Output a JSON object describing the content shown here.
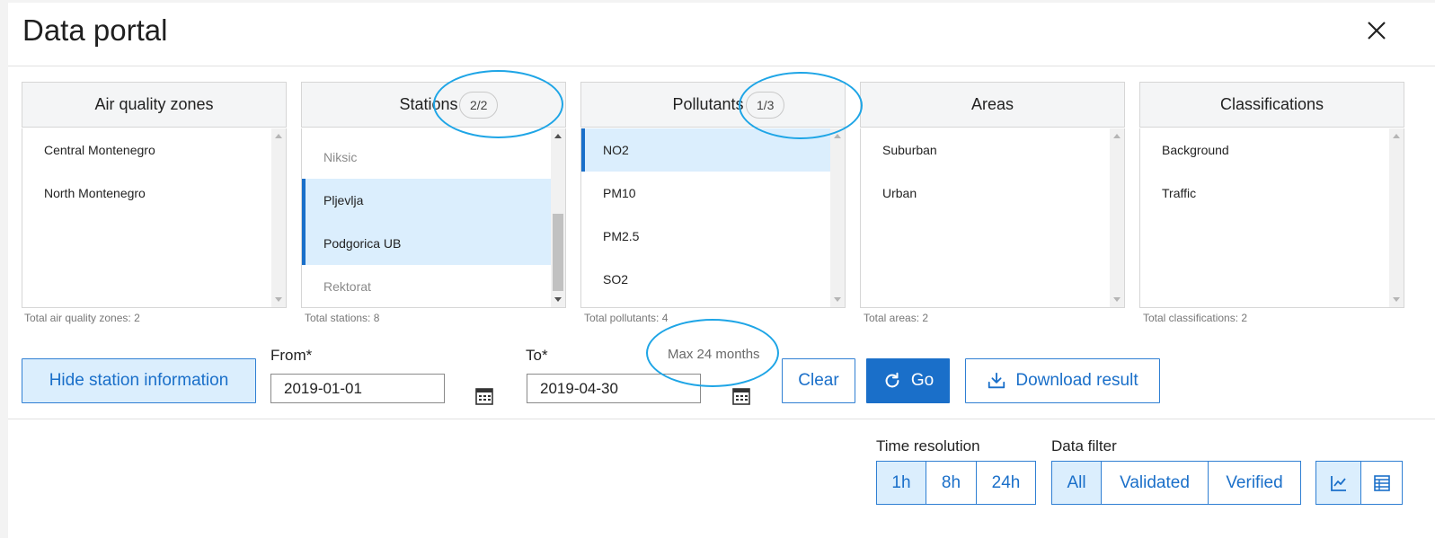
{
  "header": {
    "title": "Data portal"
  },
  "panels": {
    "zones": {
      "title": "Air quality zones",
      "items": [
        "Central Montenegro",
        "North Montenegro"
      ],
      "total": "Total air quality zones: 2"
    },
    "stations": {
      "title": "Stations",
      "required": "*",
      "badge": "2/2",
      "items": [
        "Niksic",
        "Pljevlja",
        "Podgorica UB",
        "Rektorat"
      ],
      "total": "Total stations: 8"
    },
    "pollutants": {
      "title": "Pollutants",
      "required": "*",
      "badge": "1/3",
      "items": [
        "NO2",
        "PM10",
        "PM2.5",
        "SO2"
      ],
      "total": "Total pollutants: 4"
    },
    "areas": {
      "title": "Areas",
      "items": [
        "Suburban",
        "Urban"
      ],
      "total": "Total areas: 2"
    },
    "classifications": {
      "title": "Classifications",
      "items": [
        "Background",
        "Traffic"
      ],
      "total": "Total classifications: 2"
    }
  },
  "controls": {
    "hide_station_info": "Hide station information",
    "from_label": "From*",
    "from_value": "2019-01-01",
    "to_label": "To*",
    "to_value": "2019-04-30",
    "max_hint": "Max 24 months",
    "clear": "Clear",
    "go": "Go",
    "download": "Download result"
  },
  "time_resolution": {
    "label": "Time resolution",
    "options": [
      "1h",
      "8h",
      "24h"
    ],
    "selected": "1h"
  },
  "data_filter": {
    "label": "Data filter",
    "options": [
      "All",
      "Validated",
      "Verified"
    ],
    "selected": "All"
  },
  "view_toggle": {
    "icons": [
      "chart-icon",
      "table-icon"
    ]
  },
  "colors": {
    "accent": "#1a6fc9",
    "selected_bg": "#dbeefd",
    "annotation": "#1ea5e6"
  }
}
